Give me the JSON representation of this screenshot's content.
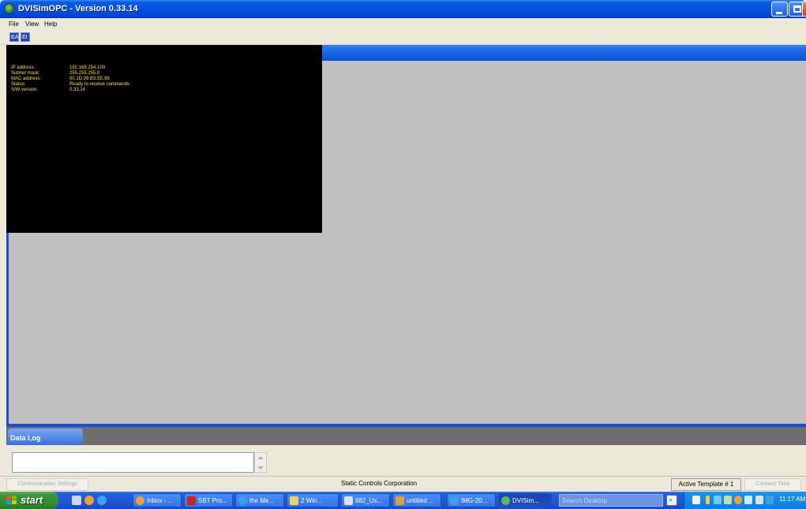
{
  "window": {
    "title": "DVISimOPC - Version 0.33.14"
  },
  "menu": {
    "items": [
      "File",
      "View",
      "Help"
    ]
  },
  "toolbar": {
    "buttons": [
      "EA",
      "EI"
    ]
  },
  "info_panel": {
    "rows": [
      {
        "label": "IP address:",
        "value": "192.168.254.100"
      },
      {
        "label": "Subnet mask:",
        "value": "255.255.255.0"
      },
      {
        "label": "MAC address:",
        "value": "00.1D.09.B3.5E.98"
      },
      {
        "label": "Status:",
        "value": "Ready to receive commands"
      },
      {
        "label": "S/W version:",
        "value": "0.33.14"
      }
    ]
  },
  "data_log": {
    "tab_label": "Data Log",
    "input_value": ""
  },
  "status_bar": {
    "communication_settings_label": "Communication Settings",
    "company": "Static Controls Corporation",
    "active_template": "Active Template # 1",
    "connect_time_label": "Connect Time"
  },
  "taskbar": {
    "start_label": "start",
    "tasks": [
      {
        "label": "Inbox - ...",
        "icon": "email-icon",
        "color": "#f0a030"
      },
      {
        "label": "SBT Pro...",
        "icon": "pdf-icon",
        "color": "#d02020"
      },
      {
        "label": "the Me...",
        "icon": "ie-icon",
        "color": "#3aa0f0"
      },
      {
        "label": "2 Win...",
        "icon": "folder-icon",
        "color": "#f0d060"
      },
      {
        "label": "982_Us...",
        "icon": "document-icon",
        "color": "#e0e0f0"
      },
      {
        "label": "untitled ...",
        "icon": "paint-icon",
        "color": "#e0a040"
      },
      {
        "label": "IMG-20...",
        "icon": "image-icon",
        "color": "#40a0e0"
      },
      {
        "label": "DVISim...",
        "icon": "dvisim-icon",
        "color": "#5cb85c"
      }
    ],
    "search_placeholder": "Search Desktop",
    "clock": "11:17 AM"
  }
}
